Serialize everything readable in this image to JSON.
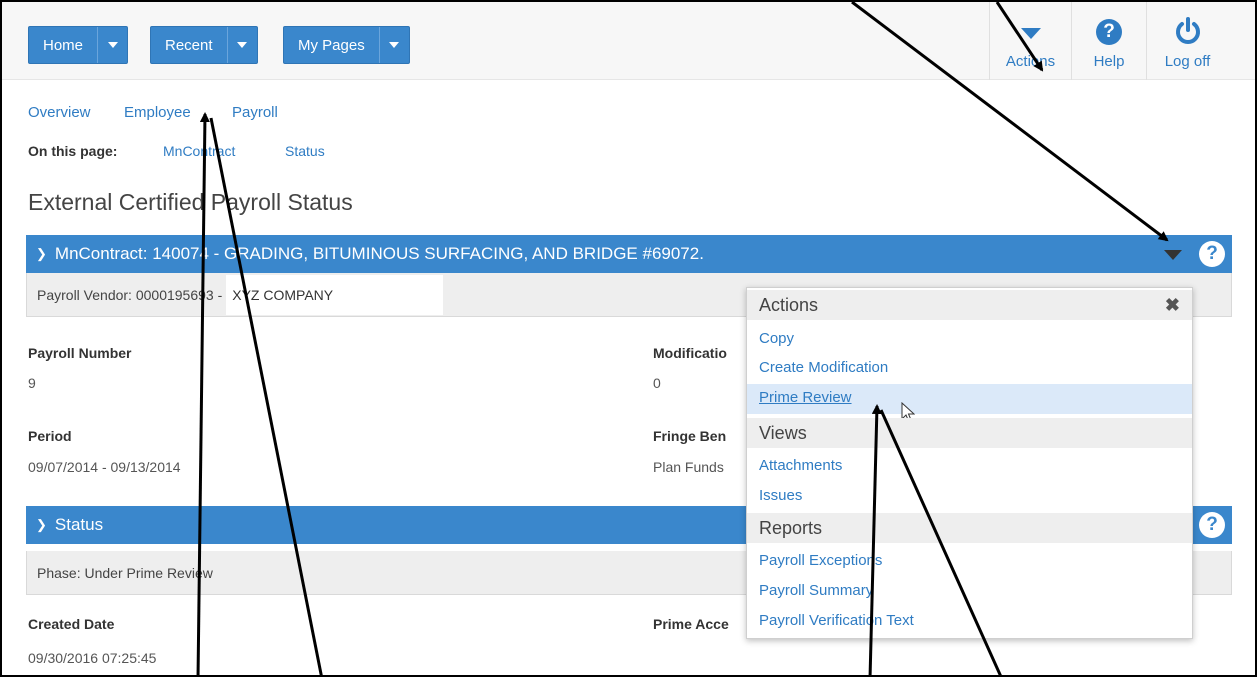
{
  "topnav": {
    "home": "Home",
    "recent": "Recent",
    "mypages": "My Pages",
    "actions": "Actions",
    "help": "Help",
    "logoff": "Log off"
  },
  "tabs": [
    "Overview",
    "Employee",
    "Payroll"
  ],
  "on_this_page": {
    "label": "On this page:",
    "links": [
      "MnContract",
      "Status"
    ]
  },
  "page_title": "External Certified Payroll Status",
  "contract_section": {
    "header": "MnContract: 140074 - GRADING, BITUMINOUS SURFACING, AND BRIDGE #69072.",
    "vendor_label": "Payroll Vendor: 0000195693 -",
    "vendor_name": "XYZ COMPANY"
  },
  "fields": {
    "payroll_number_label": "Payroll Number",
    "payroll_number_value": "9",
    "modification_label": "Modificatio",
    "modification_value": "0",
    "period_label": "Period",
    "period_value": "09/07/2014 - 09/13/2014",
    "fringe_label": "Fringe Ben",
    "fringe_value": "Plan Funds"
  },
  "status_section": {
    "header": "Status",
    "phase": "Phase: Under Prime Review",
    "created_label": "Created Date",
    "created_value": "09/30/2016 07:25:45",
    "prime_label": "Prime Acce"
  },
  "actions_menu": {
    "title": "Actions",
    "actions": [
      "Copy",
      "Create Modification",
      "Prime Review"
    ],
    "views_title": "Views",
    "views": [
      "Attachments",
      "Issues"
    ],
    "reports_title": "Reports",
    "reports": [
      "Payroll Exceptions",
      "Payroll Summary",
      "Payroll Verification Text"
    ]
  },
  "colors": {
    "accent": "#3a87cc",
    "link": "#2f7cc3",
    "highlight": "#dbe9f9"
  }
}
